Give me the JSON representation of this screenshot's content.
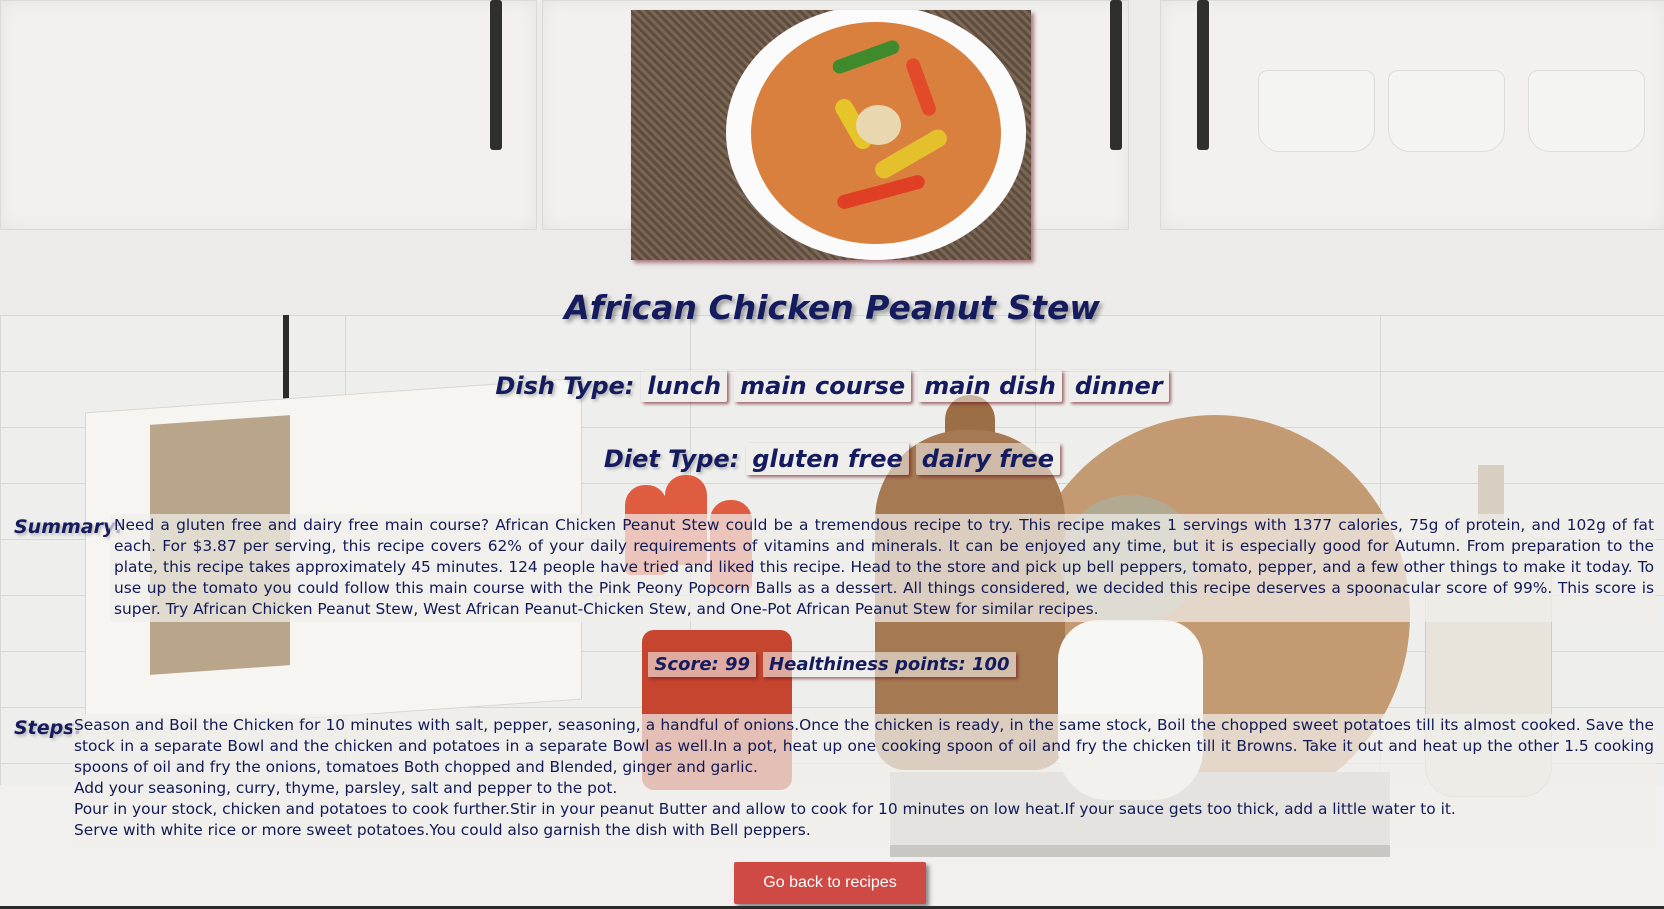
{
  "recipe": {
    "title": "African Chicken Peanut Stew",
    "dish_type_label": "Dish Type:",
    "dish_types": [
      "lunch",
      "main course",
      "main dish",
      "dinner"
    ],
    "diet_type_label": "Diet Type:",
    "diet_types": [
      "gluten free",
      "dairy free"
    ],
    "summary_label": "Summary:",
    "summary": "Need a gluten free and dairy free main course? African Chicken Peanut Stew could be a tremendous recipe to try. This recipe makes 1 servings with 1377 calories, 75g of protein, and 102g of fat each. For $3.87 per serving, this recipe covers 62% of your daily requirements of vitamins and minerals. It can be enjoyed any time, but it is especially good for Autumn. From preparation to the plate, this recipe takes approximately 45 minutes. 124 people have tried and liked this recipe. Head to the store and pick up bell peppers, tomato, pepper, and a few other things to make it today. To use up the tomato you could follow this main course with the Pink Peony Popcorn Balls as a dessert. All things considered, we decided this recipe deserves a spoonacular score of 99%. This score is super. Try African Chicken Peanut Stew, West African Peanut-Chicken Stew, and One-Pot African Peanut Stew for similar recipes.",
    "score": "Score: 99",
    "healthiness": "Healthiness points: 100",
    "steps_label": "Steps:",
    "steps": [
      "Season and Boil the Chicken for 10 minutes with salt, pepper, seasoning, a handful of onions.Once the chicken is ready, in the same stock, Boil the chopped sweet potatoes till its almost cooked. Save the stock in a separate Bowl and the chicken and potatoes in a separate Bowl as well.In a pot, heat up one cooking spoon of oil and fry the chicken till it Browns. Take it out and heat up the other 1.5 cooking spoons of oil and fry the onions, tomatoes Both chopped and Blended, ginger and garlic.",
      "Add your seasoning, curry, thyme, parsley, salt and pepper to the pot.",
      "Pour in your stock, chicken and potatoes to cook further.Stir in your peanut Butter and allow to cook for 10 minutes on low heat.If your sauce gets too thick, add a little water to it.",
      "Serve with white rice or more sweet potatoes.You could also garnish the dish with Bell peppers."
    ],
    "back_button": "Go back to recipes"
  },
  "colors": {
    "text_navy": "#141b5e",
    "button_red": "#cf4a44",
    "tag_shadow": "#6e1923"
  }
}
